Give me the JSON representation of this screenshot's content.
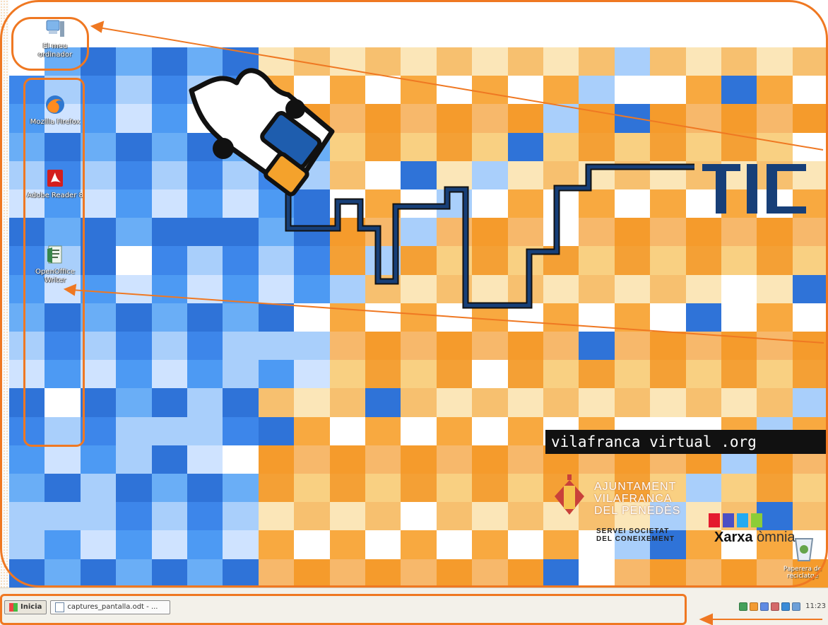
{
  "desktop_icons": [
    {
      "name": "my-computer",
      "label": "El meu ordinador",
      "icon": "computer-icon"
    },
    {
      "name": "firefox",
      "label": "Mozilla Firefox",
      "icon": "firefox-icon"
    },
    {
      "name": "adobe-reader",
      "label": "Adobe Reader 8",
      "icon": "adobe-reader-icon"
    },
    {
      "name": "openoffice-writer",
      "label": "OpenOffice Writer",
      "icon": "writer-icon"
    }
  ],
  "wallpaper": {
    "tic_text": "TIC",
    "site": "vilafranca virtual .org",
    "city_lines": [
      "AJUNTAMENT",
      "VILAFRANCA",
      "DEL PENEDÈS"
    ],
    "service_lines": [
      "SERVEI   SOCIETAT",
      "DEL CONEIXEMENT"
    ],
    "xarxa_main": "Xarxa",
    "xarxa_sub": "òmnia",
    "recycle_label": "Paperera de reciclatge"
  },
  "taskbar": {
    "start": "Inicia",
    "window": "captures_pantalla.odt - ...",
    "time": "11:23"
  },
  "colors": {
    "accent": "#ef7822",
    "blue": "#2f6ad0",
    "orange": "#f7a33b"
  }
}
